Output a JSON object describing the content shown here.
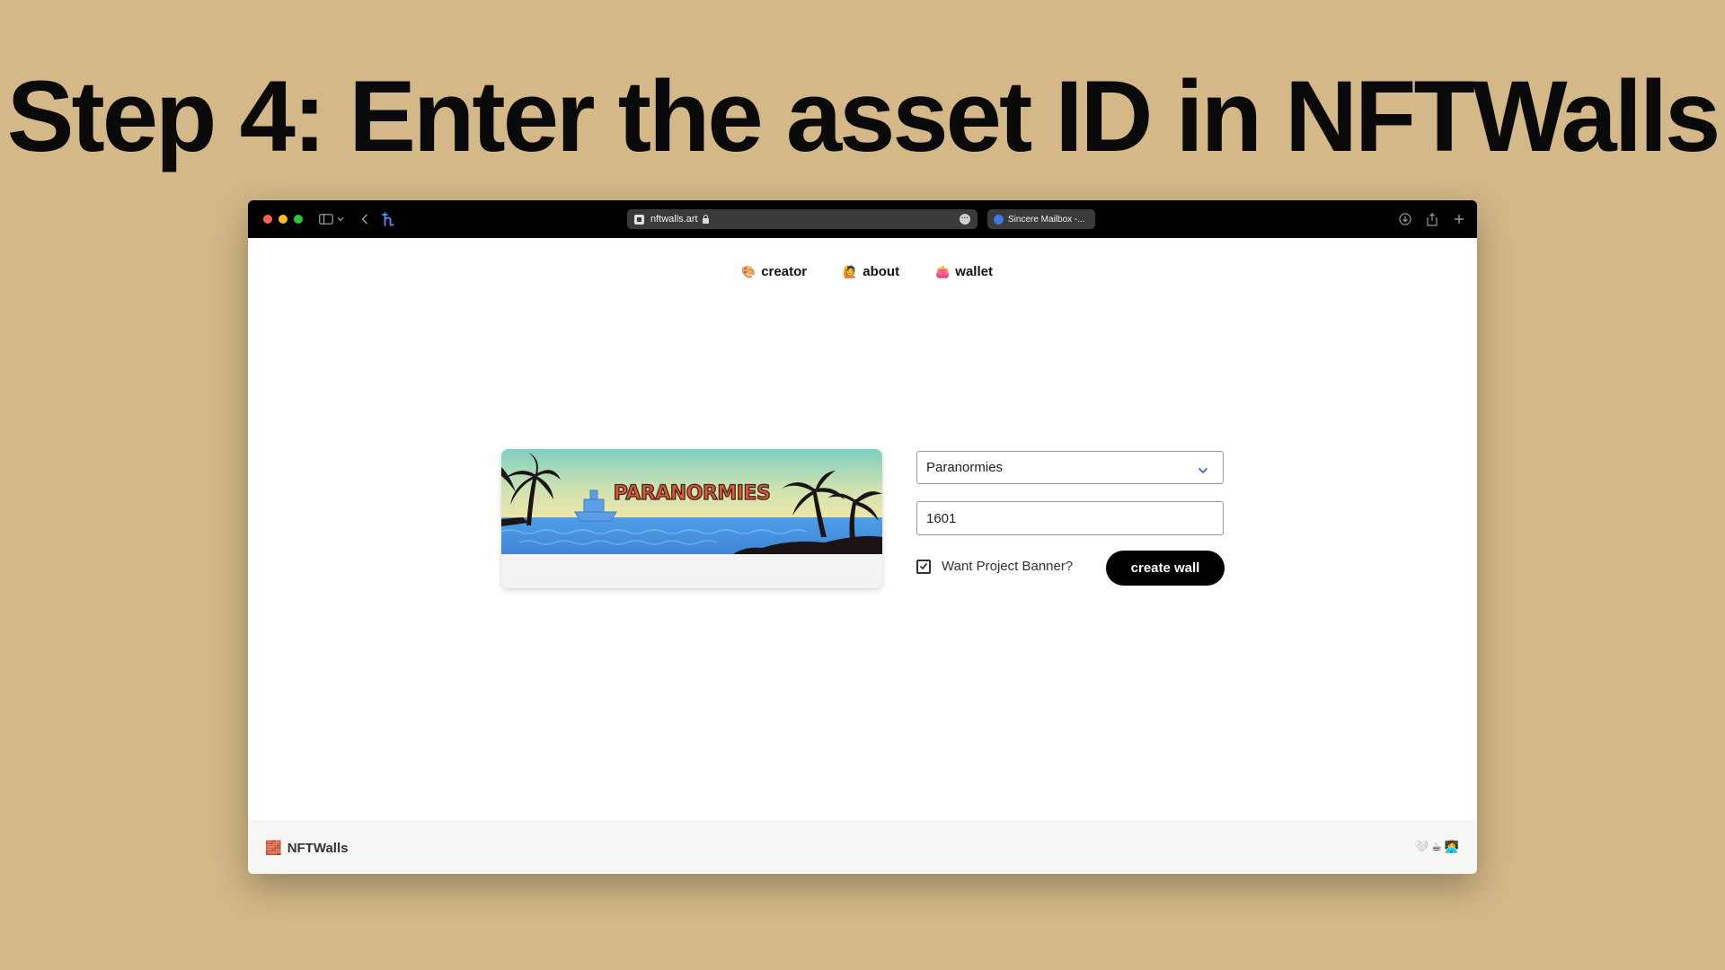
{
  "slide": {
    "title": "Step 4: Enter the asset ID in NFTWalls"
  },
  "browser": {
    "url": "nftwalls.art",
    "second_tab": "Sincere Mailbox -..."
  },
  "nav": [
    {
      "emoji": "🎨",
      "label": "creator"
    },
    {
      "emoji": "🙋",
      "label": "about"
    },
    {
      "emoji": "👛",
      "label": "wallet"
    }
  ],
  "banner": {
    "text": "PARANORMIES"
  },
  "form": {
    "collection_selected": "Paranormies",
    "asset_id_value": "1601",
    "banner_checkbox_label": "Want Project Banner?",
    "banner_checkbox_checked": true,
    "create_button_label": "create wall"
  },
  "footer": {
    "brand_emoji": "🧱",
    "brand_name": "NFTWalls",
    "icons": [
      "🤍",
      "☕",
      "🧑‍💻"
    ]
  },
  "colors": {
    "background": "#d4b888",
    "chrome": "#000000",
    "button": "#000000",
    "accent_icon": "#5b8ef0"
  }
}
